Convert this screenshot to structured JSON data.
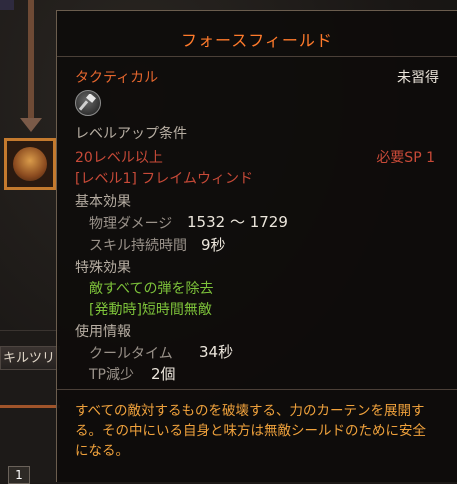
{
  "background": {
    "skill_tree_tab_label": "キルツリ",
    "slot_badge": "1"
  },
  "tooltip": {
    "title": "フォースフィールド",
    "category": "タクティカル",
    "learn_status": "未習得",
    "icon": "hammer-icon",
    "level_req_header": "レベルアップ条件",
    "level_req_value": "20レベル以上",
    "prereq_skill": "[レベル1] フレイムウィンド",
    "sp_required": "必要SP 1",
    "basic_effect_header": "基本効果",
    "physical_damage_label": "物理ダメージ",
    "physical_damage_value": "1532 ～ 1729",
    "skill_duration_label": "スキル持続時間",
    "skill_duration_value": "9秒",
    "special_effect_header": "特殊効果",
    "special_effect_1": "敵すべての弾を除去",
    "special_effect_2": "[発動時]短時間無敵",
    "usage_info_header": "使用情報",
    "cooltime_label": "クールタイム",
    "cooltime_value": "34秒",
    "tp_label": "TP減少",
    "tp_value": "2個",
    "description": "すべての敵対するものを破壊する、力のカーテンを展開する。その中にいる自身と味方は無敵シールドのために安全になる。"
  },
  "colors": {
    "title": "#ff7a2b",
    "requirement_red": "#c84a38",
    "special_green": "#7dc23a",
    "description_orange": "#f0a23c"
  }
}
